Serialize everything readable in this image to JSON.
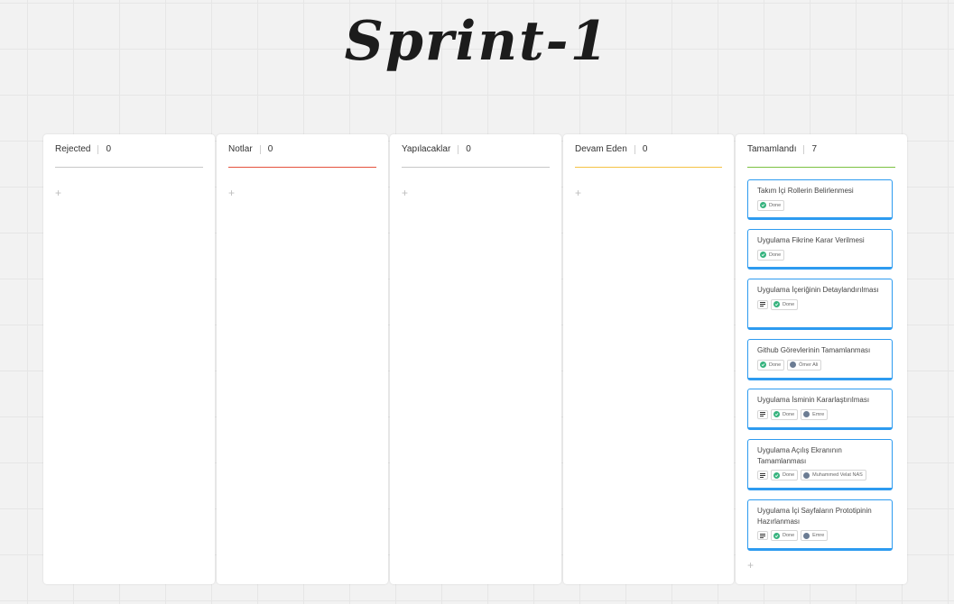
{
  "board": {
    "title": "Sprint-1",
    "columns": [
      {
        "name": "Rejected",
        "count": "0",
        "color": "#c8c8c8",
        "add": "+"
      },
      {
        "name": "Notlar",
        "count": "0",
        "color": "#e5533d",
        "add": "+"
      },
      {
        "name": "Yapılacaklar",
        "count": "0",
        "color": "#c8c8c8",
        "add": "+"
      },
      {
        "name": "Devam Eden",
        "count": "0",
        "color": "#f5c244",
        "add": "+"
      },
      {
        "name": "Tamamlandı",
        "count": "7",
        "color": "#7cc142",
        "add": "+"
      }
    ],
    "cards": [
      {
        "title": "Takım İçi Rollerin Belirlenmesi",
        "has_description": false,
        "status": "Done",
        "assignee": ""
      },
      {
        "title": "Uygulama Fikrine Karar Verilmesi",
        "has_description": false,
        "status": "Done",
        "assignee": ""
      },
      {
        "title": "Uygulama İçeriğinin Detaylandırılması",
        "has_description": true,
        "status": "Done",
        "assignee": ""
      },
      {
        "title": "Github Görevlerinin Tamamlanması",
        "has_description": false,
        "status": "Done",
        "assignee": "Ömer Ali"
      },
      {
        "title": "Uygulama İsminin Kararlaştırılması",
        "has_description": true,
        "status": "Done",
        "assignee": "Emre"
      },
      {
        "title": "Uygulama Açılış Ekranının Tamamlanması",
        "has_description": true,
        "status": "Done",
        "assignee": "Muhammed Velat NAS"
      },
      {
        "title": "Uygulama İçi Sayfaların Prototipinin Hazırlanması",
        "has_description": true,
        "status": "Done",
        "assignee": "Emre"
      }
    ],
    "colors": {
      "card_border": "#2d9bf0",
      "done_green": "#36b37e",
      "background": "#f2f2f2"
    }
  }
}
